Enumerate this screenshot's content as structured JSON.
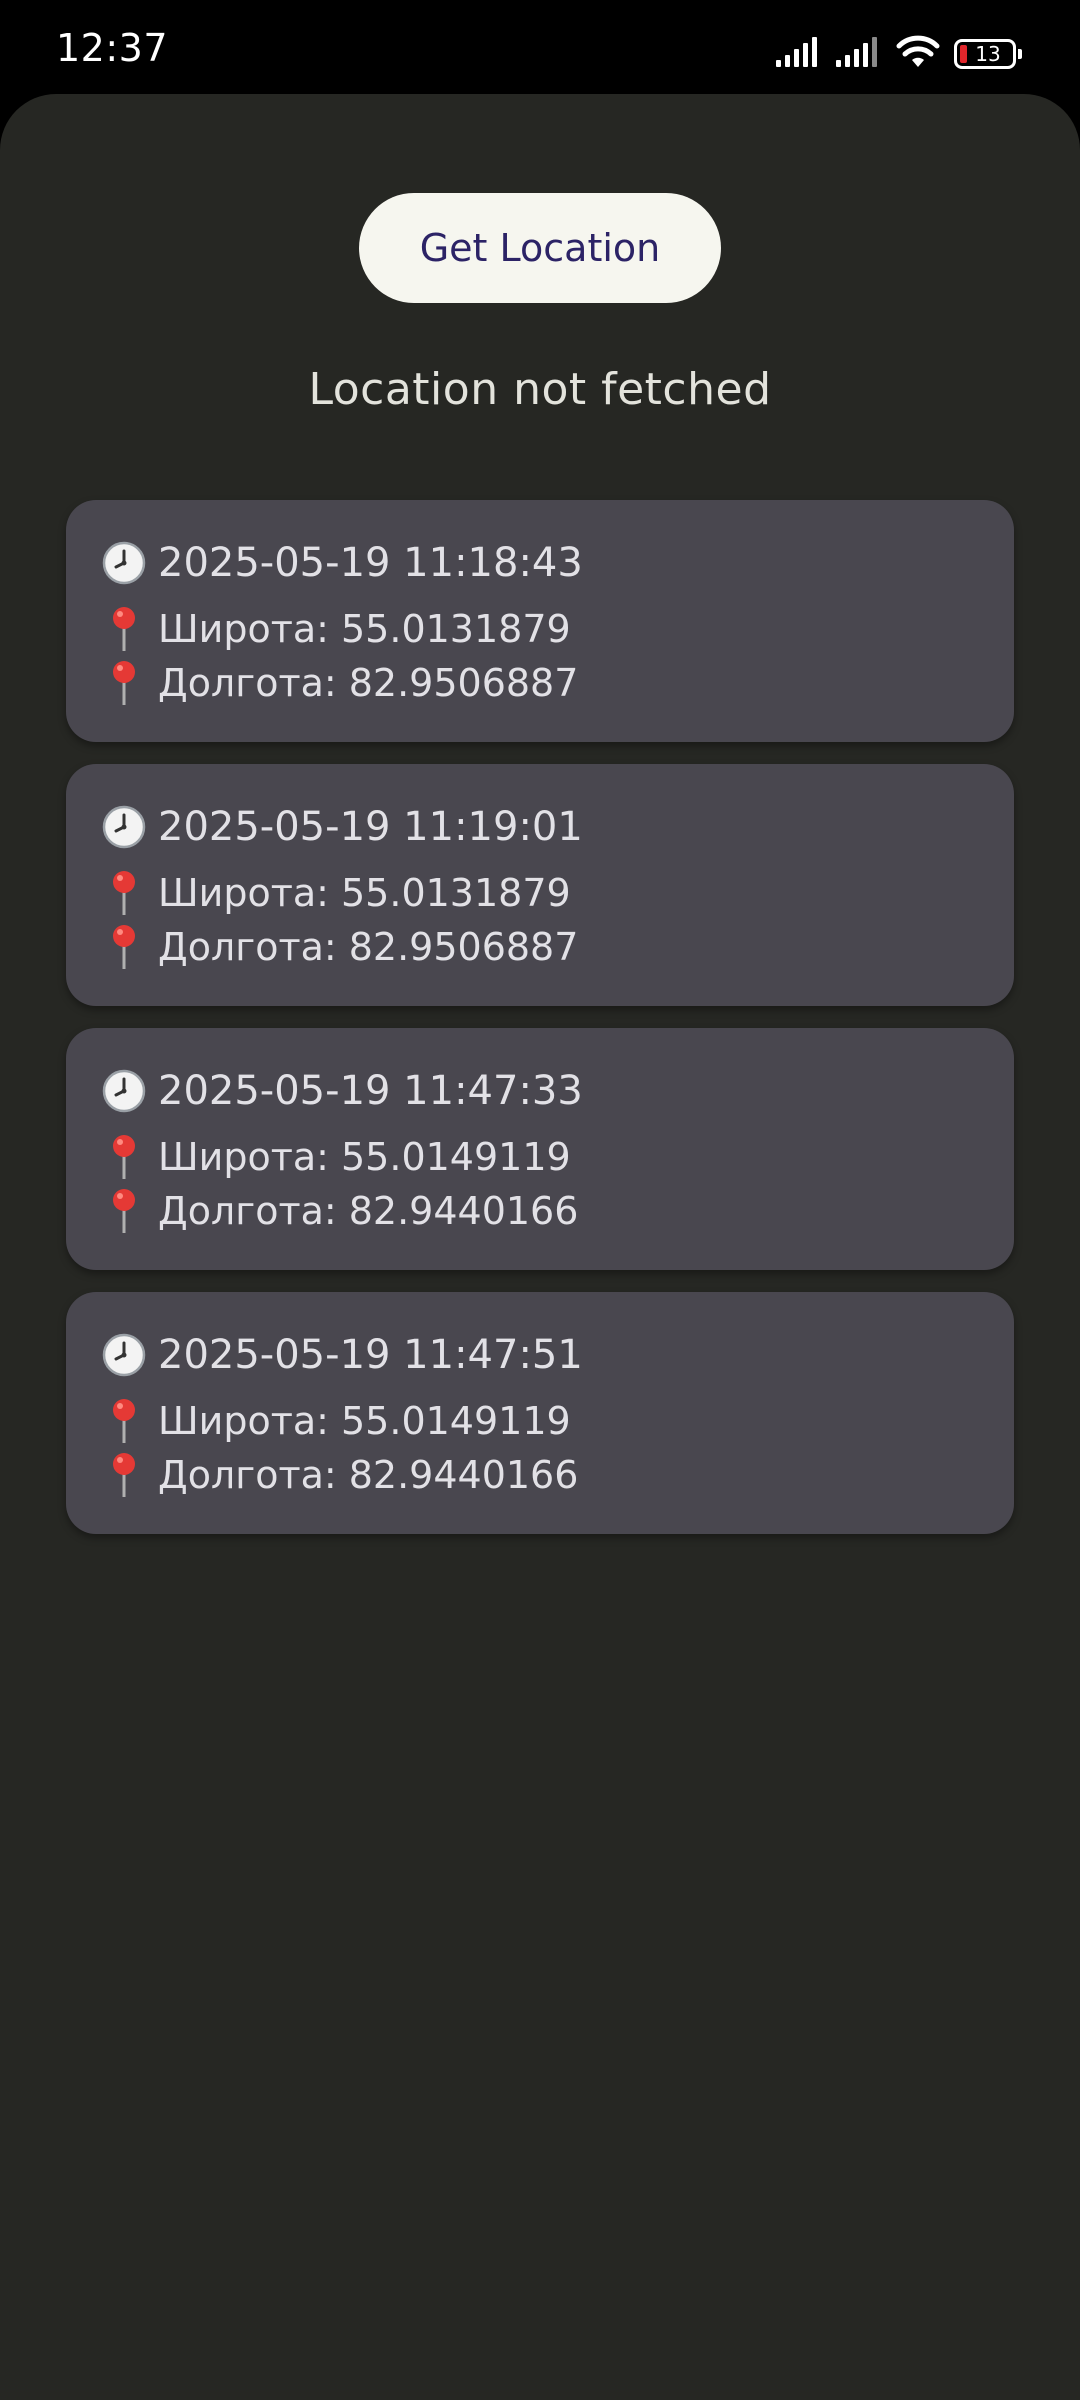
{
  "status_bar": {
    "time": "12:37",
    "battery": "13",
    "icons": [
      "signal-icon",
      "signal-icon",
      "wifi-icon",
      "battery-icon"
    ]
  },
  "actions": {
    "get_location_label": "Get Location"
  },
  "status_text": "Location not fetched",
  "history": [
    {
      "time": "2025-05-19 11:18:43",
      "latitude": "Широта: 55.0131879",
      "longitude": "Долгота: 82.9506887"
    },
    {
      "time": "2025-05-19 11:19:01",
      "latitude": "Широта: 55.0131879",
      "longitude": "Долгота: 82.9506887"
    },
    {
      "time": "2025-05-19 11:47:33",
      "latitude": "Широта: 55.0149119",
      "longitude": "Долгота: 82.9440166"
    },
    {
      "time": "2025-05-19 11:47:51",
      "latitude": "Широта: 55.0149119",
      "longitude": "Долгота: 82.9440166"
    }
  ],
  "icons": {
    "time": "clock-icon",
    "coordinate": "pin-icon"
  },
  "colors": {
    "background": "#262723",
    "card": "#49474f",
    "button": "#f6f6ef",
    "button_text": "#2c2366",
    "pin": "#e53935",
    "battery_low": "#e0262b"
  }
}
